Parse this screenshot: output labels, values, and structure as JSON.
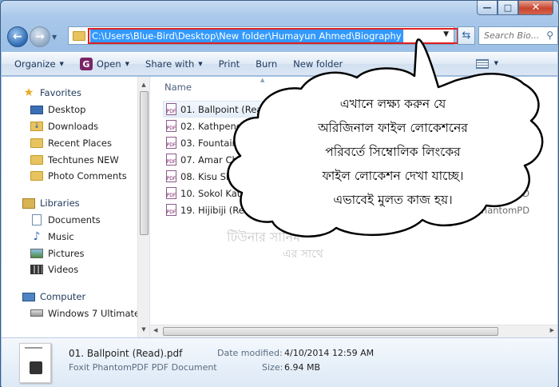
{
  "window": {
    "caption_min": "—",
    "caption_max": "□",
    "caption_close": "✕"
  },
  "nav": {
    "back_icon": "back-arrow-icon",
    "forward_icon": "forward-arrow-icon",
    "address": "C:\\Users\\Blue-Bird\\Desktop\\New folder\\Humayun Ahmed\\Biography",
    "search_placeholder": "Search Bio..."
  },
  "toolbar": {
    "organize": "Organize",
    "open": "Open",
    "share_with": "Share with",
    "print": "Print",
    "burn": "Burn",
    "new_folder": "New folder"
  },
  "sidebar": {
    "favorites": "Favorites",
    "favorites_items": [
      "Desktop",
      "Downloads",
      "Recent Places",
      "Techtunes NEW",
      "Photo Comments"
    ],
    "libraries": "Libraries",
    "libraries_items": [
      "Documents",
      "Music",
      "Pictures",
      "Videos"
    ],
    "computer": "Computer",
    "computer_items": [
      "Windows 7 Ultimate"
    ]
  },
  "filelist": {
    "column_name": "Name",
    "files": [
      {
        "name": "01. Ballpoint (Read).pdf",
        "type": "PhantomPD"
      },
      {
        "name": "02. Kathpencil.pdf",
        "type": ""
      },
      {
        "name": "03. Fountain Pen.pdf",
        "type": ""
      },
      {
        "name": "07. Amar Chelebela (Re",
        "type": ""
      },
      {
        "name": "08. Kisu Shoisob (Read",
        "type": ""
      },
      {
        "name": "10. Sokol Kata Dhonno",
        "type": "PhantomPD"
      },
      {
        "name": "19. Hijibiji (Read).pdf",
        "type": "PhantomPD"
      }
    ],
    "watermark_line1": "টিউনার সানিম",
    "watermark_line2": "এর সাথে"
  },
  "details": {
    "file_name": "01. Ballpoint (Read).pdf",
    "file_type": "Foxit PhantomPDF PDF Document",
    "date_label": "Date modified:",
    "date_value": "4/10/2014 12:59 AM",
    "size_label": "Size:",
    "size_value": "6.94 MB"
  },
  "callout": {
    "text": "এখানে লক্ষ্য করুন যে\nঅরিজিনাল ফাইল লোকেশনের\nপরিবর্তে সিম্বোলিক লিংকের\nফাইল লোকেশন দেখা যাচ্ছে।\nএভাবেই মুলত কাজ হয়।"
  },
  "colors": {
    "address_highlight": "#3399ff",
    "address_border": "#e02020",
    "selected_row": "#e4eef9"
  }
}
